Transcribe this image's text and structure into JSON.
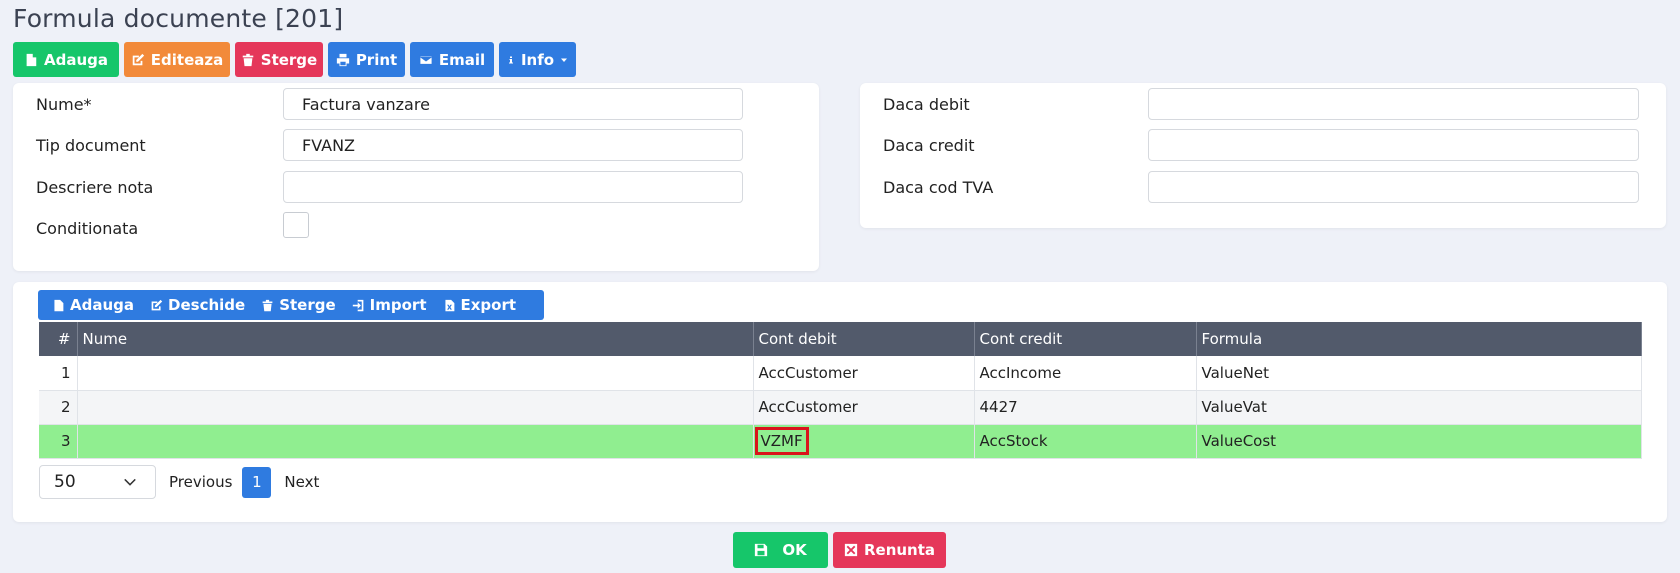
{
  "page": {
    "title": "Formula documente [201]"
  },
  "toolbar": {
    "add": "Adauga",
    "edit": "Editeaza",
    "delete": "Sterge",
    "print": "Print",
    "email": "Email",
    "info": "Info"
  },
  "form_left": {
    "nume_label": "Nume*",
    "nume_value": "Factura vanzare",
    "tip_label": "Tip document",
    "tip_value": "FVANZ",
    "descriere_label": "Descriere nota",
    "descriere_value": "",
    "conditionata_label": "Conditionata"
  },
  "form_right": {
    "debit_label": "Daca debit",
    "debit_value": "",
    "credit_label": "Daca credit",
    "credit_value": "",
    "tva_label": "Daca cod TVA",
    "tva_value": ""
  },
  "grid_toolbar": {
    "add": "Adauga",
    "open": "Deschide",
    "delete": "Sterge",
    "import": "Import",
    "export": "Export"
  },
  "grid": {
    "columns": [
      "#",
      "Nume",
      "Cont debit",
      "Cont credit",
      "Formula"
    ],
    "rows": [
      {
        "num": "1",
        "nume": "",
        "debit": "AccCustomer",
        "credit": "AccIncome",
        "formula": "ValueNet"
      },
      {
        "num": "2",
        "nume": "",
        "debit": "AccCustomer",
        "credit": "4427",
        "formula": "ValueVat"
      },
      {
        "num": "3",
        "nume": "",
        "debit": "VZMF",
        "credit": "AccStock",
        "formula": "ValueCost"
      }
    ]
  },
  "pager": {
    "page_size": "50",
    "previous": "Previous",
    "current": "1",
    "next": "Next"
  },
  "footer": {
    "ok": "OK",
    "cancel": "Renunta"
  },
  "colors": {
    "green": "#16c66a",
    "orange": "#f28a3a",
    "red": "#e5375a",
    "blue": "#2f7be0",
    "header": "#525a6b",
    "selected_row": "#90ee90",
    "highlight_border": "#d9151b"
  }
}
